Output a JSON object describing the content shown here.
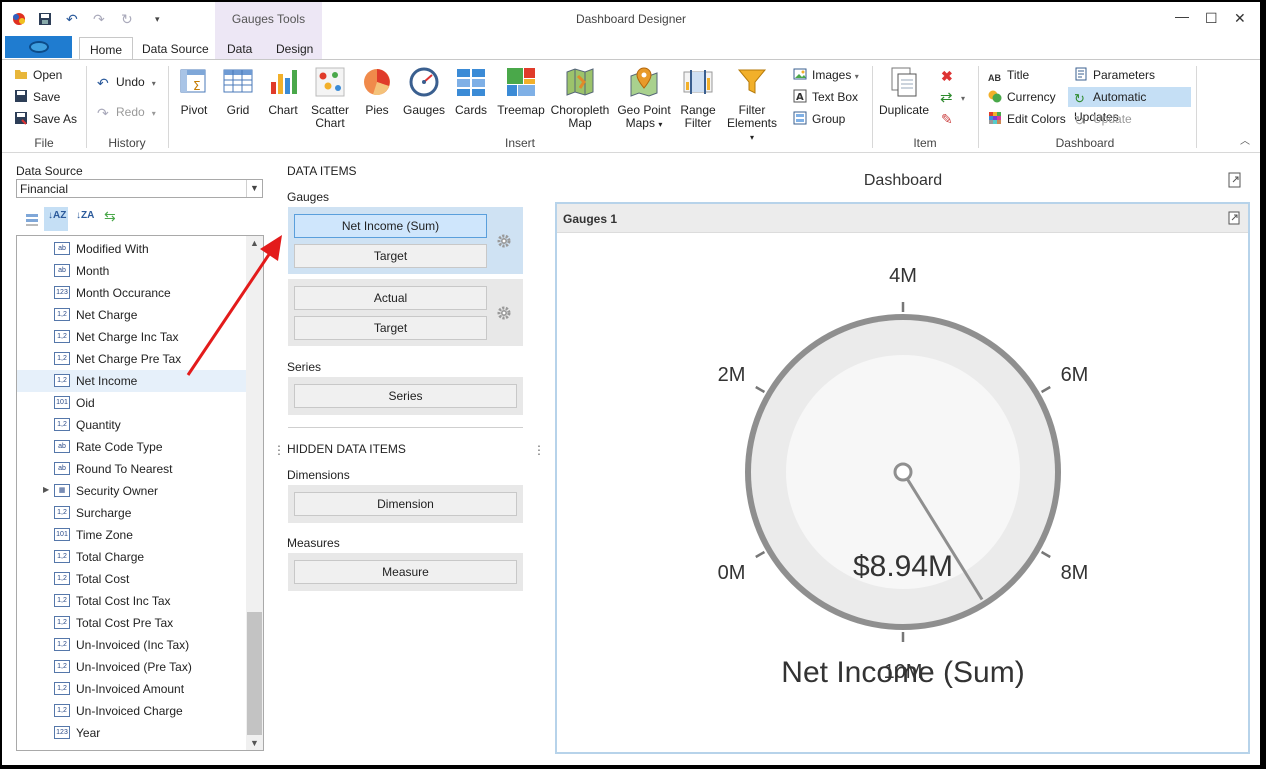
{
  "window": {
    "title": "Dashboard Designer",
    "context_tab_group": "Gauges Tools"
  },
  "tabs": [
    "Home",
    "Data Source",
    "Data",
    "Design"
  ],
  "ribbon": {
    "file": {
      "open": "Open",
      "save": "Save",
      "save_as": "Save As",
      "label": "File"
    },
    "history": {
      "undo": "Undo",
      "redo": "Redo",
      "label": "History"
    },
    "insert": {
      "label": "Insert",
      "pivot": "Pivot",
      "grid": "Grid",
      "chart": "Chart",
      "scatter_1": "Scatter",
      "scatter_2": "Chart",
      "pies": "Pies",
      "gauges": "Gauges",
      "cards": "Cards",
      "treemap": "Treemap",
      "choropleth_1": "Choropleth",
      "choropleth_2": "Map",
      "geo_1": "Geo Point",
      "geo_2": "Maps",
      "range_1": "Range",
      "range_2": "Filter",
      "filter_1": "Filter",
      "filter_2": "Elements",
      "images": "Images",
      "text_box": "Text Box",
      "group": "Group"
    },
    "item": {
      "label": "Item",
      "duplicate": "Duplicate"
    },
    "dashboard": {
      "label": "Dashboard",
      "title": "Title",
      "currency": "Currency",
      "edit_colors": "Edit Colors",
      "parameters": "Parameters",
      "automatic_updates": "Automatic Updates",
      "update": "Update"
    }
  },
  "left_panel": {
    "data_source_label": "Data Source",
    "data_source_value": "Financial",
    "fields": [
      {
        "label": "Modified With",
        "type": "ab"
      },
      {
        "label": "Month",
        "type": "ab"
      },
      {
        "label": "Month Occurance",
        "type": "123"
      },
      {
        "label": "Net Charge",
        "type": "1,2"
      },
      {
        "label": "Net Charge Inc Tax",
        "type": "1,2"
      },
      {
        "label": "Net Charge Pre Tax",
        "type": "1,2"
      },
      {
        "label": "Net Income",
        "type": "1,2"
      },
      {
        "label": "Oid",
        "type": "101"
      },
      {
        "label": "Quantity",
        "type": "1,2"
      },
      {
        "label": "Rate Code Type",
        "type": "ab"
      },
      {
        "label": "Round To Nearest",
        "type": "ab"
      },
      {
        "label": "Security Owner",
        "type": "grid"
      },
      {
        "label": "Surcharge",
        "type": "1,2"
      },
      {
        "label": "Time Zone",
        "type": "101"
      },
      {
        "label": "Total Charge",
        "type": "1,2"
      },
      {
        "label": "Total Cost",
        "type": "1,2"
      },
      {
        "label": "Total Cost Inc Tax",
        "type": "1,2"
      },
      {
        "label": "Total Cost Pre Tax",
        "type": "1,2"
      },
      {
        "label": "Un-Invoiced (Inc Tax)",
        "type": "1,2"
      },
      {
        "label": "Un-Invoiced (Pre Tax)",
        "type": "1,2"
      },
      {
        "label": "Un-Invoiced Amount",
        "type": "1,2"
      },
      {
        "label": "Un-Invoiced Charge",
        "type": "1,2"
      },
      {
        "label": "Year",
        "type": "123"
      }
    ]
  },
  "data_items": {
    "header": "DATA ITEMS",
    "gauges_label": "Gauges",
    "gauge1_value": "Net Income (Sum)",
    "gauge1_target": "Target",
    "gauge2_value": "Actual",
    "gauge2_target": "Target",
    "series_label": "Series",
    "series_slot": "Series",
    "hidden_header": "HIDDEN DATA ITEMS",
    "dimensions_label": "Dimensions",
    "dimension_slot": "Dimension",
    "measures_label": "Measures",
    "measure_slot": "Measure"
  },
  "dashboard": {
    "title": "Dashboard",
    "item_caption": "Gauges 1",
    "gauge": {
      "value_text": "$8.94M",
      "label": "Net Income (Sum)",
      "min": 0,
      "max": 10000000,
      "value": 8940000,
      "ticks": [
        "0M",
        "2M",
        "4M",
        "6M",
        "8M",
        "10M"
      ]
    }
  }
}
